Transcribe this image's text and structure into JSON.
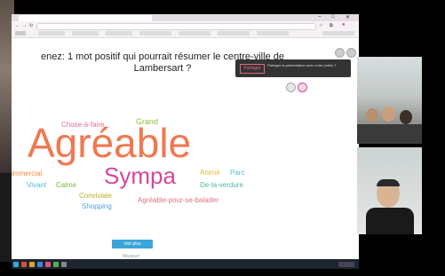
{
  "question": {
    "line1": "enez: 1 mot positif qui pourrait résumer le centre-ville de",
    "line2": "Lambersart ?"
  },
  "wordcloud": [
    {
      "text": "Chose-à-faire",
      "color": "#e06f8f",
      "size": 8
    },
    {
      "text": "Grand",
      "color": "#8fbf3a",
      "size": 9
    },
    {
      "text": "Agréable",
      "color": "#f07850",
      "size": 46
    },
    {
      "text": "Sympa",
      "color": "#d4479a",
      "size": 26
    },
    {
      "text": "immercial",
      "color": "#f08a40",
      "size": 8
    },
    {
      "text": "Animé",
      "color": "#e8b830",
      "size": 8
    },
    {
      "text": "Parc",
      "color": "#4fb8d8",
      "size": 8
    },
    {
      "text": "Vivant",
      "color": "#4fb8d8",
      "size": 8
    },
    {
      "text": "Calme",
      "color": "#7ab840",
      "size": 8
    },
    {
      "text": "De-la-verdure",
      "color": "#4fb8a8",
      "size": 8
    },
    {
      "text": "Conviviale",
      "color": "#b8b020",
      "size": 8
    },
    {
      "text": "Agréable-pour-se-balader",
      "color": "#e06f7f",
      "size": 8
    },
    {
      "text": "Shopping",
      "color": "#4fa0d8",
      "size": 8
    }
  ],
  "notification": {
    "button_label": "Partager",
    "message": "Partager la présentation avec votre public ?"
  },
  "buttons": {
    "see_more": "Voir plus",
    "link_small": "Masquer"
  },
  "colors": {
    "accent": "#3aa5d8",
    "notif_bg": "#333333"
  }
}
